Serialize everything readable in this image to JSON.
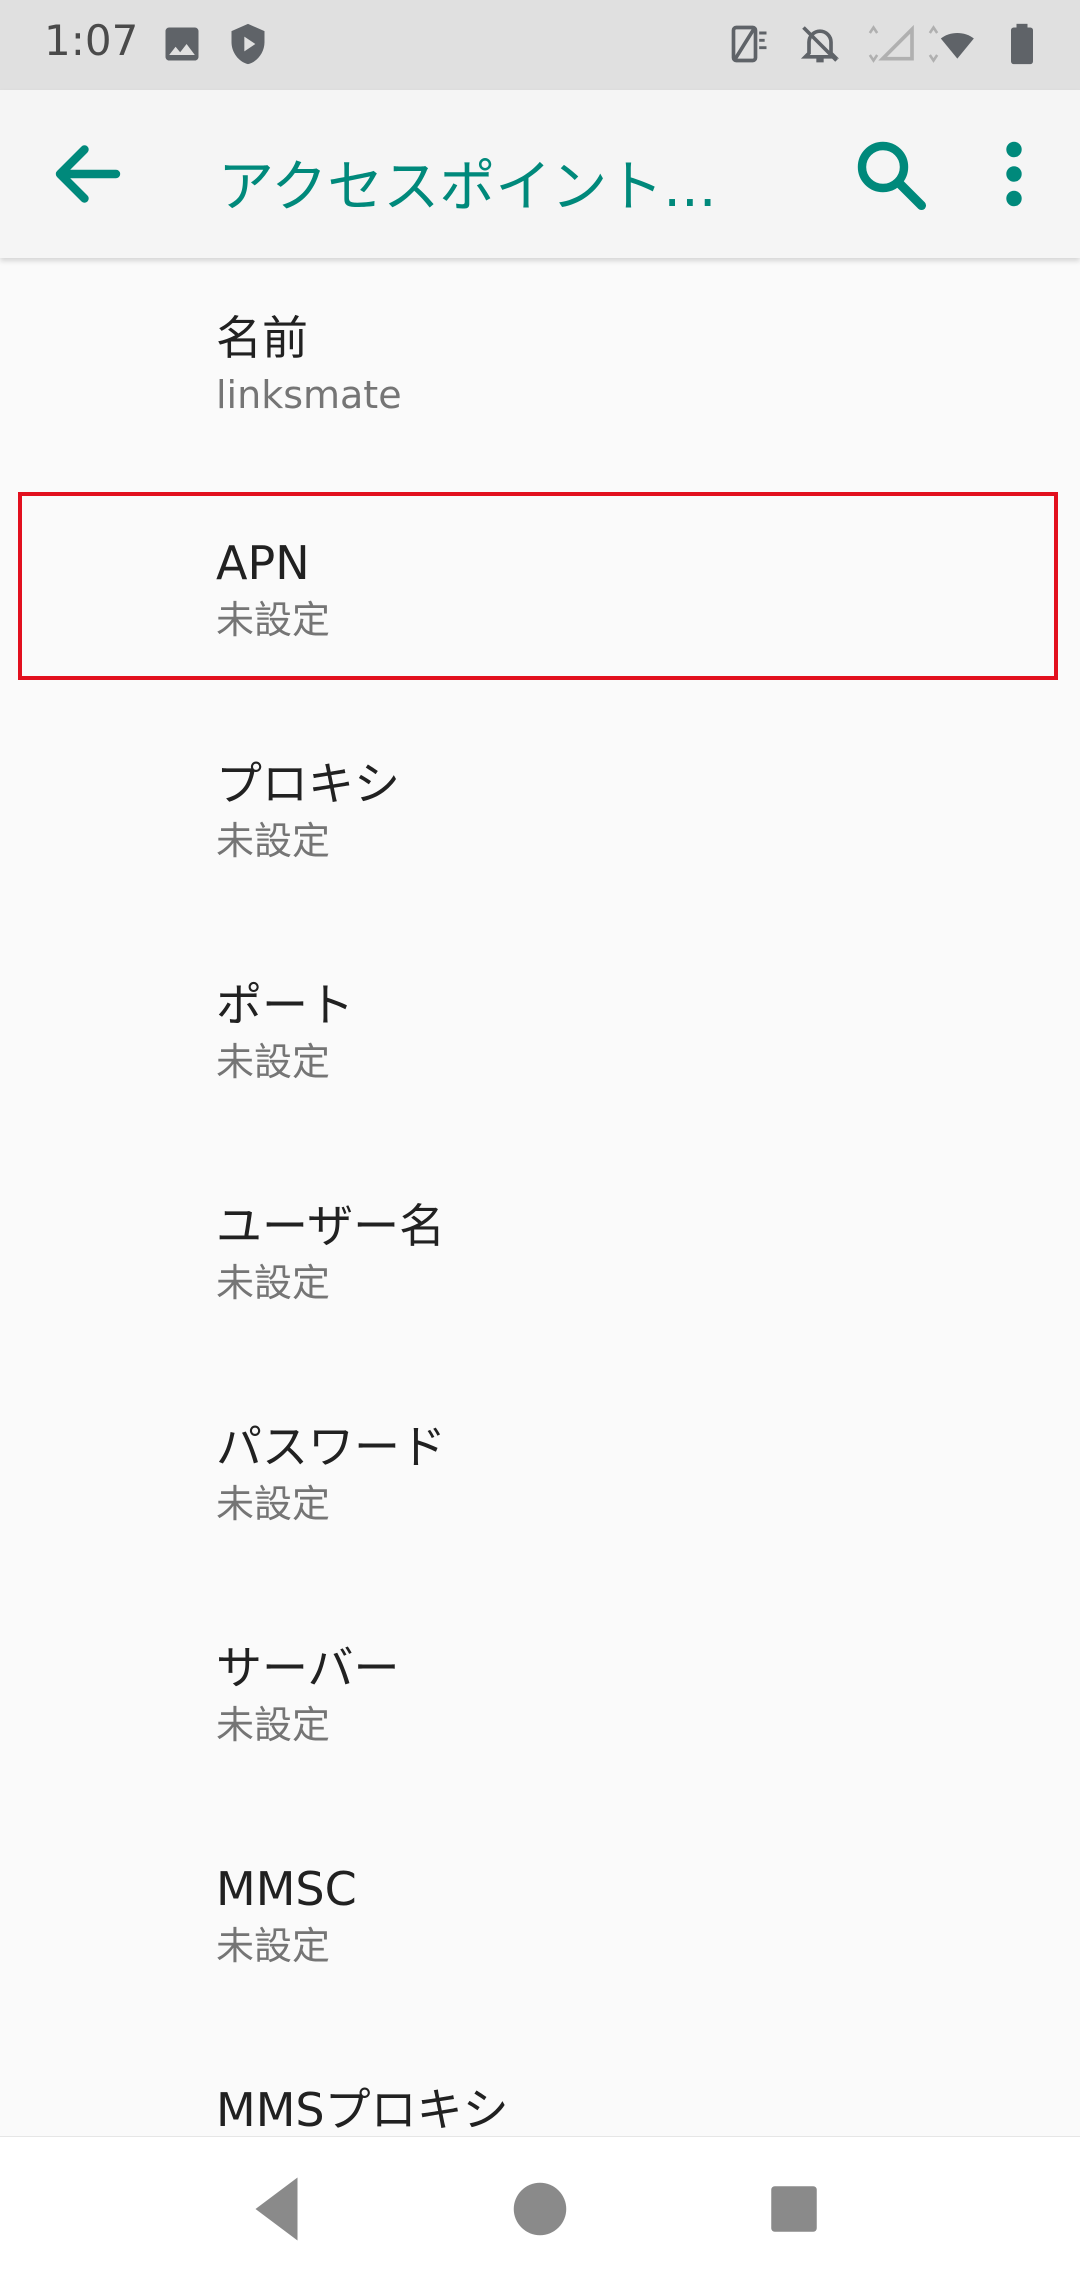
{
  "status_bar": {
    "time": "1:07",
    "icons": [
      "image-icon",
      "shield-icon",
      "screen-rotate-icon",
      "notifications-off-icon",
      "signal-icon",
      "wifi-icon",
      "battery-icon"
    ]
  },
  "app_bar": {
    "title": "アクセスポイント...",
    "back_icon": "arrow-left-icon",
    "search_icon": "search-icon",
    "more_icon": "more-vert-icon",
    "accent": "#00897b"
  },
  "items": [
    {
      "label": "名前",
      "value": "linksmate"
    },
    {
      "label": "APN",
      "value": "未設定"
    },
    {
      "label": "プロキシ",
      "value": "未設定"
    },
    {
      "label": "ポート",
      "value": "未設定"
    },
    {
      "label": "ユーザー名",
      "value": "未設定"
    },
    {
      "label": "パスワード",
      "value": "未設定"
    },
    {
      "label": "サーバー",
      "value": "未設定"
    },
    {
      "label": "MMSC",
      "value": "未設定"
    },
    {
      "label": "MMSプロキシ",
      "value": ""
    }
  ],
  "highlight_color": "#e2101e",
  "nav_bar": {
    "icons": [
      "back-triangle-icon",
      "home-circle-icon",
      "recents-square-icon"
    ]
  }
}
